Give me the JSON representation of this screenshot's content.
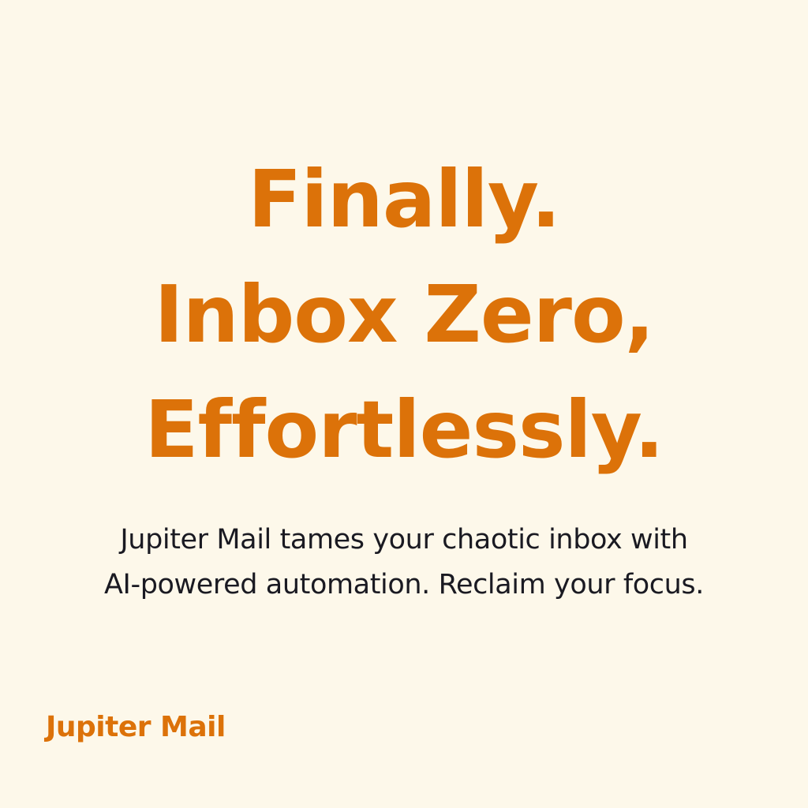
{
  "hero": {
    "headline_lines": [
      "Finally.",
      "Inbox Zero,",
      "Effortlessly."
    ],
    "subtext_lines": [
      "Jupiter Mail tames your chaotic inbox with",
      "AI-powered automation. Reclaim your focus."
    ]
  },
  "brand": {
    "name": "Jupiter Mail"
  },
  "colors": {
    "background": "#fdf8ea",
    "accent": "#dc7209",
    "text": "#1a1a22"
  }
}
